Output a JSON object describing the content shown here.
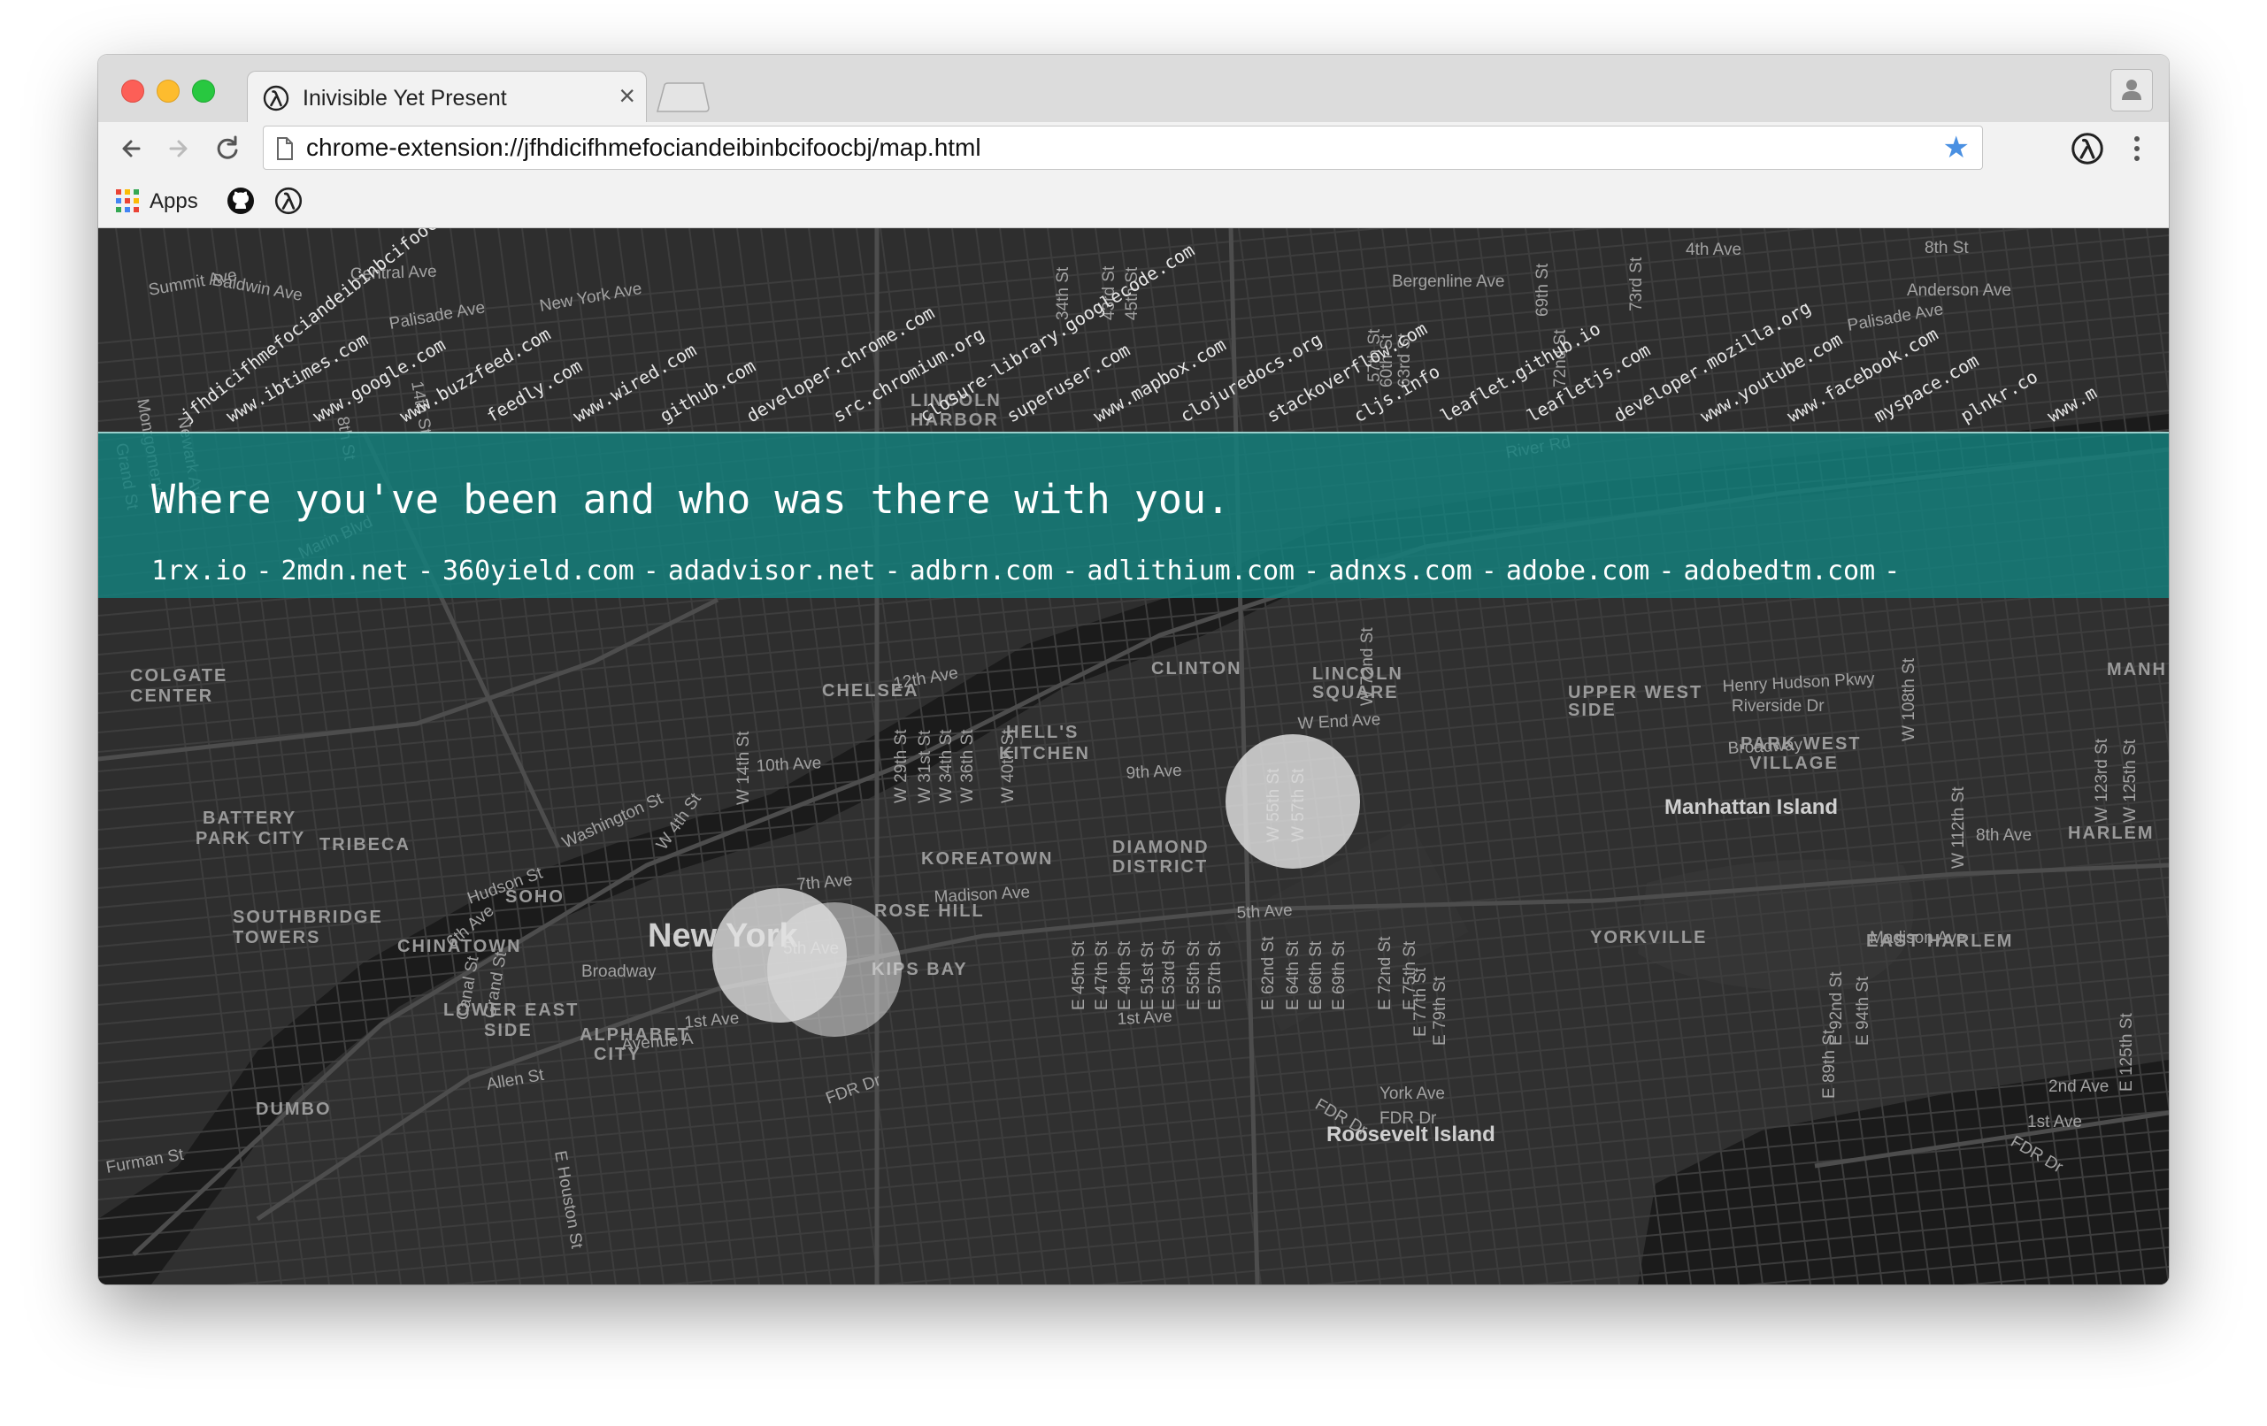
{
  "browser": {
    "tab_title": "Inivisible Yet Present",
    "tab_close": "×",
    "url": "chrome-extension://jfhdicifhmefociandeibinbcifoocbj/map.html",
    "bookmark_star": "★",
    "bookmarks": {
      "apps_label": "Apps"
    }
  },
  "page": {
    "headline": "Where you've been and who was there with you.",
    "domains": [
      "1rx.io",
      "2mdn.net",
      "360yield.com",
      "adadvisor.net",
      "adbrn.com",
      "adlithium.com",
      "adnxs.com",
      "adobe.com",
      "adobedtm.com"
    ],
    "domain_separator": "-",
    "site_labels": [
      "jfhdicifhmefociandeibinbcifoocbj",
      "www.ibtimes.com",
      "www.google.com",
      "www.buzzfeed.com",
      "feedly.com",
      "www.wired.com",
      "github.com",
      "developer.chrome.com",
      "src.chromium.org",
      "closure-library.googlecode.com",
      "superuser.com",
      "www.mapbox.com",
      "clojuredocs.org",
      "stackoverflow.com",
      "cljs.info",
      "leaflet.github.io",
      "leafletjs.com",
      "developer.mozilla.org",
      "www.youtube.com",
      "www.facebook.com",
      "myspace.com",
      "plnkr.co",
      "www.m"
    ]
  },
  "map": {
    "big_labels": [
      "New York",
      "Manhattan Island",
      "Roosevelt Island"
    ],
    "district_labels": [
      "COLGATE",
      "CENTER",
      "BATTERY",
      "PARK CITY",
      "TRIBECA",
      "SOHO",
      "SOUTHBRIDGE",
      "TOWERS",
      "CHINATOWN",
      "LOWER EAST",
      "SIDE",
      "ALPHABET",
      "CITY",
      "CHELSEA",
      "HELL'S",
      "KITCHEN",
      "CLINTON",
      "KOREATOWN",
      "ROSE HILL",
      "KIPS BAY",
      "DIAMOND",
      "DISTRICT",
      "LINCOLN",
      "SQUARE",
      "UPPER WEST",
      "SIDE",
      "PARK WEST",
      "VILLAGE",
      "YORKVILLE",
      "EAST HARLEM",
      "HARLEM",
      "MANH",
      "LINCOLN",
      "HARBOR",
      "DUMBO"
    ],
    "street_labels": [
      "Summit Ave",
      "Baldwin Ave",
      "Central Ave",
      "New York Ave",
      "Palisade Ave",
      "Montgomery St",
      "Newark Ave",
      "8th St",
      "14th St",
      "Marin Blvd",
      "Grand St",
      "12th Ave",
      "10th Ave",
      "Washington St",
      "Hudson St",
      "W 4th St",
      "6th Ave",
      "7th Ave",
      "W 14th St",
      "5th Ave",
      "Broadway",
      "Canal St",
      "Grand St",
      "Allen St",
      "E Houston St",
      "1st Ave",
      "Avenue A",
      "FDR Dr",
      "Furman St",
      "FDR Dr",
      "W 29th St",
      "W 31st St",
      "W 34th St",
      "W 36th St",
      "W 40th St",
      "9th Ave",
      "W End Ave",
      "W 72nd St",
      "Madison Ave",
      "5th Ave",
      "1st Ave",
      "E 45th St",
      "E 47th St",
      "E 49th St",
      "E 51st St",
      "E 53rd St",
      "E 55th St",
      "E 57th St",
      "E 62nd St",
      "E 64th St",
      "E 66th St",
      "E 69th St",
      "E 72nd St",
      "E 75th St",
      "E 77th St",
      "E 79th St",
      "York Ave",
      "FDR Dr",
      "Henry Hudson Pkwy",
      "Riverside Dr",
      "Broadway",
      "W 108th St",
      "8th Ave",
      "W 112th St",
      "W 123rd St",
      "W 125th St",
      "Madison Ave",
      "E 89th St",
      "E 92nd St",
      "E 94th St",
      "2nd Ave",
      "1st Ave",
      "FDR Dr",
      "E 125th St",
      "River Rd",
      "Bergenline Ave",
      "Anderson Ave",
      "4th Ave",
      "8th St",
      "Palisade Ave",
      "W 55th St",
      "W 57th St",
      "34th St",
      "43rd St",
      "45th St",
      "73rd St",
      "69th St",
      "57th St",
      "60th St",
      "63rd St",
      "72nd St"
    ]
  }
}
